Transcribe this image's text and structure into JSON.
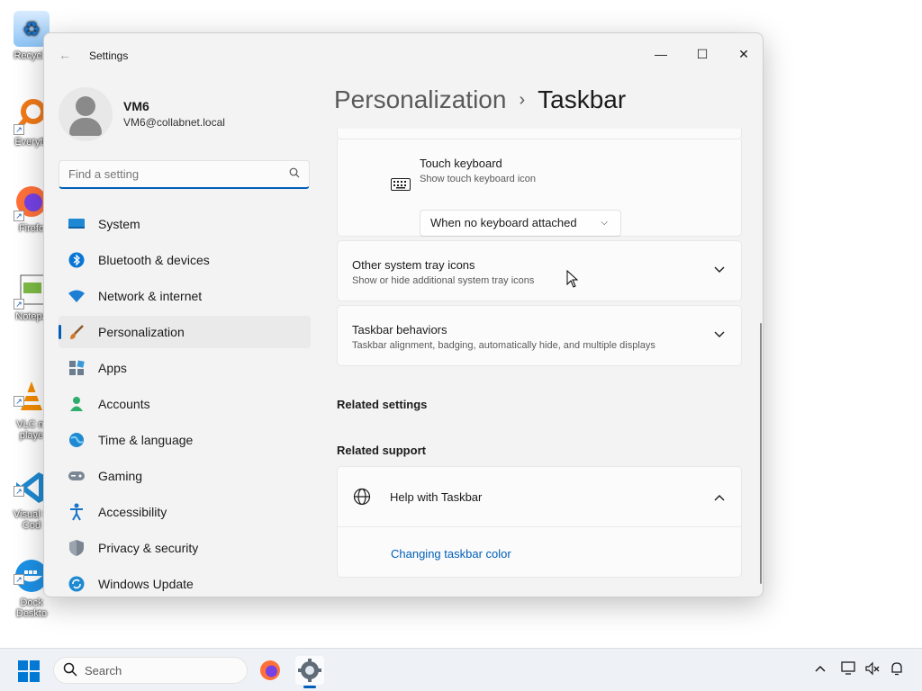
{
  "desktop": {
    "icons": [
      {
        "label": "Recycle",
        "icon": "recycle-bin-icon"
      },
      {
        "label": "Everyth",
        "icon": "everything-search-icon"
      },
      {
        "label": "Firefo",
        "icon": "firefox-icon"
      },
      {
        "label": "Notepa",
        "icon": "notepad-icon"
      },
      {
        "label": "VLC m\nplaye",
        "icon": "vlc-icon"
      },
      {
        "label": "Visual S\nCod",
        "icon": "vscode-icon"
      },
      {
        "label": "Dock\nDeskto",
        "icon": "docker-icon"
      }
    ]
  },
  "window": {
    "title": "Settings",
    "controls": {
      "minimize": "—",
      "maximize": "☐",
      "close": "✕"
    }
  },
  "profile": {
    "name": "VM6",
    "email": "VM6@collabnet.local"
  },
  "search": {
    "placeholder": "Find a setting"
  },
  "nav": {
    "items": [
      {
        "label": "System",
        "icon": "system-icon"
      },
      {
        "label": "Bluetooth & devices",
        "icon": "bluetooth-icon"
      },
      {
        "label": "Network & internet",
        "icon": "wifi-icon"
      },
      {
        "label": "Personalization",
        "icon": "brush-icon",
        "active": true
      },
      {
        "label": "Apps",
        "icon": "apps-icon"
      },
      {
        "label": "Accounts",
        "icon": "account-icon"
      },
      {
        "label": "Time & language",
        "icon": "globe-clock-icon"
      },
      {
        "label": "Gaming",
        "icon": "gamepad-icon"
      },
      {
        "label": "Accessibility",
        "icon": "accessibility-icon"
      },
      {
        "label": "Privacy & security",
        "icon": "shield-icon"
      },
      {
        "label": "Windows Update",
        "icon": "update-icon"
      }
    ]
  },
  "breadcrumb": {
    "parent": "Personalization",
    "separator": "›",
    "current": "Taskbar"
  },
  "main": {
    "touch_keyboard": {
      "title": "Touch keyboard",
      "subtitle": "Show touch keyboard icon",
      "selected": "When no keyboard attached"
    },
    "other_tray_icons": {
      "title": "Other system tray icons",
      "subtitle": "Show or hide additional system tray icons"
    },
    "taskbar_behaviors": {
      "title": "Taskbar behaviors",
      "subtitle": "Taskbar alignment, badging, automatically hide, and multiple displays"
    },
    "related_settings": "Related settings",
    "related_support": "Related support",
    "help": {
      "title": "Help with Taskbar",
      "link": "Changing taskbar color"
    }
  },
  "taskbar": {
    "search_label": "Search",
    "apps": [
      "firefox-icon",
      "settings-gear-icon"
    ],
    "tray": [
      "chevron-up-icon",
      "network-icon",
      "volume-muted-icon",
      "notification-bell-icon"
    ]
  },
  "colors": {
    "accent": "#005fb8",
    "window_bg": "#f3f3f3",
    "card_bg": "#fbfbfb",
    "taskbar_bg": "#eef2f6"
  }
}
